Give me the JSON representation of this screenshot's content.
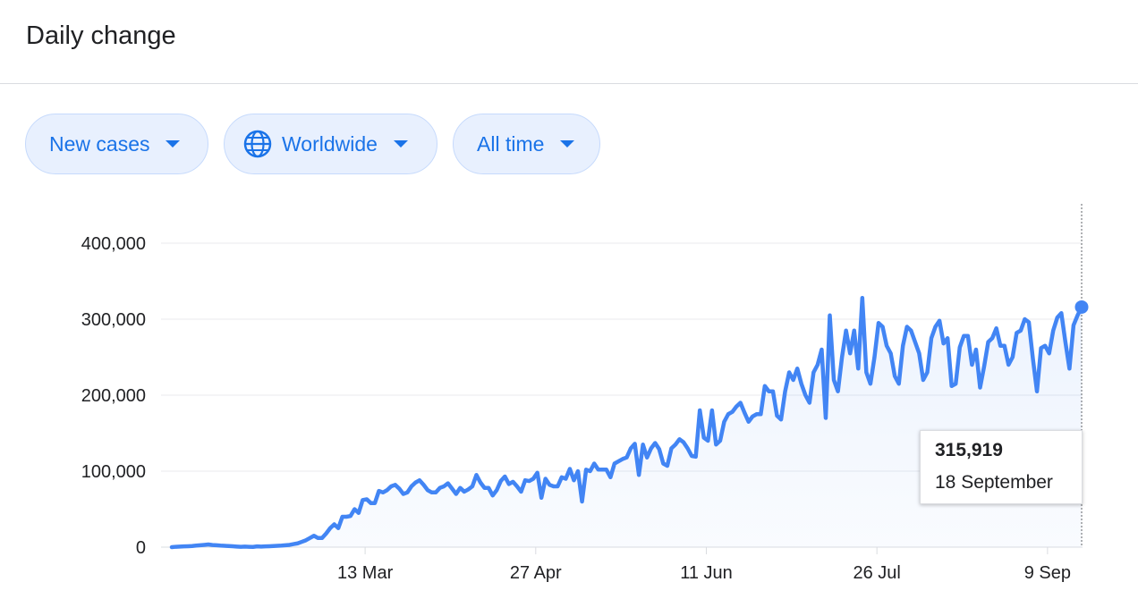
{
  "header": {
    "title": "Daily change"
  },
  "filters": {
    "metric": "New cases",
    "region": "Worldwide",
    "range": "All time"
  },
  "icons": {
    "region_icon": "globe-icon",
    "dropdown_icon": "caret-down-icon"
  },
  "colors": {
    "accent": "#1a73e8",
    "line": "#4285f4",
    "chip_bg": "#e8f0fe"
  },
  "tooltip": {
    "value": "315,919",
    "date": "18 September"
  },
  "chart_data": {
    "type": "area",
    "title": "",
    "xlabel": "",
    "ylabel": "",
    "ylim": [
      0,
      400000
    ],
    "yticks": [
      0,
      100000,
      200000,
      300000,
      400000
    ],
    "ytick_labels": [
      "0",
      "100,000",
      "200,000",
      "300,000",
      "400,000"
    ],
    "x_start": "2020-01-22",
    "x_end": "2020-09-18",
    "xticks": [
      "2020-03-13",
      "2020-04-27",
      "2020-06-11",
      "2020-07-26",
      "2020-09-09"
    ],
    "xtick_labels": [
      "13 Mar",
      "27 Apr",
      "11 Jun",
      "26 Jul",
      "9 Sep"
    ],
    "grid": true,
    "highlight": {
      "x": "2020-09-18",
      "y": 315919
    },
    "series": [
      {
        "values": [
          0,
          500,
          800,
          1000,
          1200,
          1500,
          2000,
          2500,
          3000,
          3500,
          2800,
          2500,
          2000,
          1800,
          1500,
          1200,
          800,
          500,
          800,
          500,
          300,
          1000,
          800,
          1000,
          1200,
          1500,
          1800,
          2000,
          2500,
          3000,
          4000,
          5000,
          7000,
          9000,
          12000,
          15000,
          12000,
          12000,
          18000,
          25000,
          30000,
          25000,
          40000,
          40000,
          41000,
          50000,
          45000,
          62000,
          63000,
          58000,
          58000,
          74000,
          72000,
          75000,
          80000,
          82000,
          77000,
          70000,
          72000,
          80000,
          85000,
          88000,
          82000,
          75000,
          72000,
          72000,
          78000,
          80000,
          84000,
          77000,
          70000,
          78000,
          73000,
          76000,
          80000,
          95000,
          85000,
          78000,
          78000,
          68000,
          75000,
          87000,
          93000,
          83000,
          86000,
          80000,
          73000,
          88000,
          87000,
          90000,
          98000,
          65000,
          90000,
          82000,
          80000,
          80000,
          92000,
          90000,
          103000,
          88000,
          100000,
          60000,
          102000,
          100000,
          110000,
          102000,
          102000,
          102000,
          92000,
          110000,
          113000,
          116000,
          118000,
          130000,
          136000,
          95000,
          135000,
          118000,
          130000,
          137000,
          129000,
          110000,
          107000,
          130000,
          135000,
          142000,
          138000,
          130000,
          120000,
          119000,
          180000,
          144000,
          140000,
          180000,
          135000,
          140000,
          165000,
          175000,
          178000,
          185000,
          190000,
          177000,
          165000,
          172000,
          175000,
          175000,
          212000,
          205000,
          205000,
          173000,
          168000,
          205000,
          230000,
          220000,
          235000,
          215000,
          200000,
          190000,
          230000,
          240000,
          260000,
          170000,
          305000,
          220000,
          205000,
          250000,
          285000,
          255000,
          285000,
          235000,
          328000,
          230000,
          215000,
          250000,
          295000,
          290000,
          265000,
          255000,
          225000,
          215000,
          265000,
          290000,
          285000,
          270000,
          255000,
          220000,
          230000,
          275000,
          290000,
          298000,
          268000,
          275000,
          212000,
          215000,
          263000,
          278000,
          278000,
          240000,
          260000,
          210000,
          238000,
          270000,
          275000,
          288000,
          265000,
          265000,
          240000,
          250000,
          282000,
          285000,
          300000,
          296000,
          248000,
          205000,
          262000,
          265000,
          255000,
          285000,
          302000,
          308000,
          270000,
          235000,
          292000,
          305000,
          315919
        ]
      }
    ]
  }
}
